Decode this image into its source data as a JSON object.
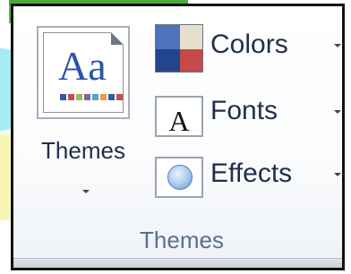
{
  "ribbon": {
    "themes_button": {
      "label": "Themes",
      "preview_text": "Aa"
    },
    "colors_button": {
      "label": "Colors"
    },
    "fonts_button": {
      "label": "Fonts",
      "icon_text": "A"
    },
    "effects_button": {
      "label": "Effects"
    },
    "group_label": "Themes"
  },
  "colors": {
    "accent_blue": "#2b55a6",
    "swatch_stripe": [
      "#2e5aa8",
      "#c0504d",
      "#9bbb59",
      "#8064a2",
      "#4bacc6",
      "#f79646",
      "#2e5aa8",
      "#c0504d"
    ],
    "colors_icon": {
      "top_left": "#4e73b9",
      "top_right": "#e6e0cf",
      "bottom_left": "#24458c",
      "bottom_right": "#c74a4a"
    }
  },
  "icons": [
    "themes-gallery-icon",
    "colors-icon",
    "fonts-icon",
    "effects-icon",
    "dropdown-caret-icon"
  ]
}
